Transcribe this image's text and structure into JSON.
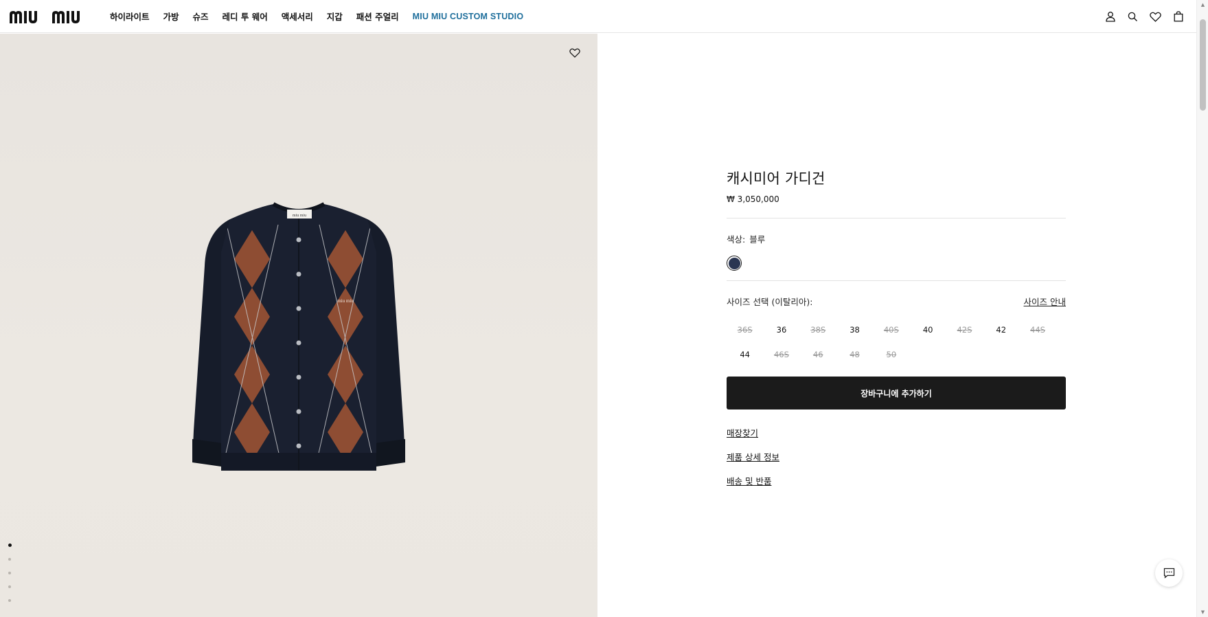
{
  "header": {
    "nav": [
      "하이라이트",
      "가방",
      "슈즈",
      "레디 투 웨어",
      "액세서리",
      "지갑",
      "패션 주얼리"
    ],
    "nav_accent": "MIU MIU CUSTOM STUDIO",
    "icons": [
      "user-icon",
      "search-icon",
      "heart-icon",
      "shopping-bag-icon"
    ]
  },
  "brand": {
    "logo_text": "miu miu",
    "accent_color": "#1f6f9c"
  },
  "product": {
    "title": "캐시미어 가디건",
    "price": "₩ 3,050,000",
    "color_label": "색상:",
    "color_value": "블루",
    "swatch_color": "#2a3652",
    "size_label": "사이즈 선택 (이탈리아):",
    "size_guide": "사이즈 안내",
    "sizes": [
      {
        "label": "36S",
        "available": false
      },
      {
        "label": "36",
        "available": true
      },
      {
        "label": "38S",
        "available": false
      },
      {
        "label": "38",
        "available": true
      },
      {
        "label": "40S",
        "available": false
      },
      {
        "label": "40",
        "available": true
      },
      {
        "label": "42S",
        "available": false
      },
      {
        "label": "42",
        "available": true
      },
      {
        "label": "44S",
        "available": false
      },
      {
        "label": "44",
        "available": true
      },
      {
        "label": "46S",
        "available": false
      },
      {
        "label": "46",
        "available": false
      },
      {
        "label": "48",
        "available": false
      },
      {
        "label": "50",
        "available": false
      }
    ],
    "add_to_cart": "장바구니에 추가하기",
    "links": [
      "매장찾기",
      "제품 상세 정보",
      "배송 및 반품"
    ]
  },
  "gallery": {
    "image_count": 5,
    "active_index": 0,
    "image_label": "miu miu"
  }
}
